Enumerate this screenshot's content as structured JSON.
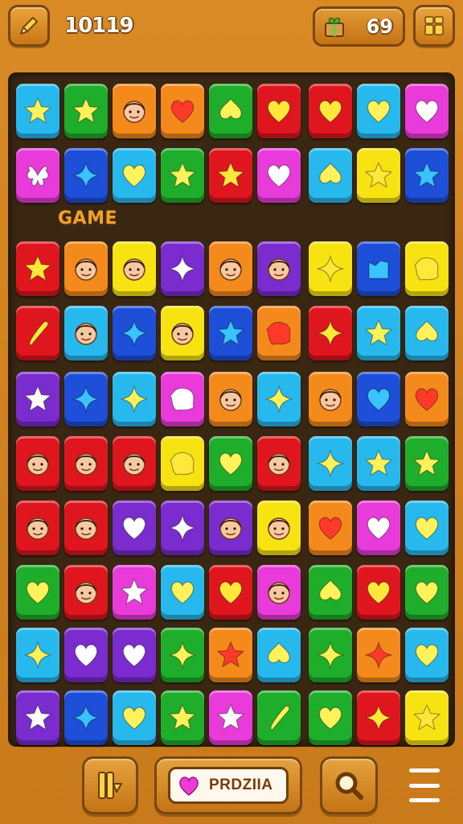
{
  "hud": {
    "score": "10119",
    "coins": "69"
  },
  "board": {
    "label": "GAME",
    "columns": [
      18,
      78,
      138,
      198,
      258,
      318,
      382,
      442,
      502
    ],
    "rows": [
      102,
      182,
      298,
      378,
      460,
      540,
      620,
      700,
      778,
      856
    ],
    "tiles": [
      [
        "cyan:star",
        "green:star",
        "orange:face",
        "orange:heart",
        "green:spade",
        "red:heart",
        "red:heart",
        "cyan:heart",
        "magenta:heart"
      ],
      [
        "magenta:flower",
        "blue:sparkle",
        "cyan:heart",
        "green:star",
        "red:star",
        "magenta:heart",
        "cyan:spade",
        "yellow:star",
        "blue:star"
      ],
      [
        "red:star",
        "orange:face",
        "yellow:face",
        "purple:sparkle",
        "orange:face",
        "purple:face",
        "yellow:sparkle",
        "blue:bag",
        "yellow:blob"
      ],
      [
        "red:stick",
        "cyan:face",
        "blue:sparkle",
        "yellow:face",
        "blue:star",
        "orange:blob",
        "red:sparkle",
        "cyan:star",
        "cyan:spade"
      ],
      [
        "purple:star",
        "blue:sparkle",
        "cyan:sparkle",
        "magenta:blob",
        "orange:face",
        "cyan:sparkle",
        "orange:face",
        "blue:heart",
        "orange:heart"
      ],
      [
        "red:face",
        "red:face",
        "red:face",
        "yellow:blob",
        "green:heart",
        "red:face",
        "cyan:sparkle",
        "cyan:star",
        "green:star"
      ],
      [
        "red:face",
        "red:face",
        "purple:heart",
        "purple:sparkle",
        "purple:face",
        "yellow:face",
        "orange:heart",
        "magenta:heart",
        "cyan:heart"
      ],
      [
        "green:heart",
        "red:face",
        "magenta:star",
        "cyan:heart",
        "red:heart",
        "magenta:face",
        "green:spade",
        "red:heart",
        "green:heart"
      ],
      [
        "cyan:sparkle",
        "purple:heart",
        "purple:heart",
        "green:sparkle",
        "orange:star",
        "cyan:spade",
        "green:sparkle",
        "orange:sparkle",
        "cyan:heart"
      ],
      [
        "purple:star",
        "blue:sparkle",
        "cyan:heart",
        "green:star",
        "magenta:star",
        "green:stick",
        "green:heart",
        "red:sparkle",
        "yellow:star"
      ]
    ]
  },
  "bottom": {
    "name_text": "PRDZIIA"
  },
  "colors": {
    "cyan": "#27b9ee",
    "green": "#1fae2b",
    "orange": "#f58a1c",
    "red": "#e0161e",
    "magenta": "#e83bd9",
    "blue": "#1e4fd8",
    "yellow": "#f7e312",
    "purple": "#7a2ccf"
  }
}
